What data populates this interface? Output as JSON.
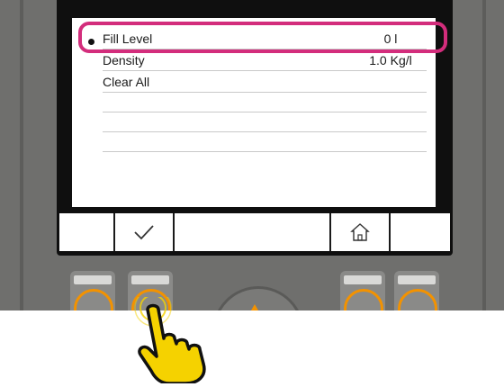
{
  "menu": {
    "items": [
      {
        "label": "Fill Level",
        "value": "0 l",
        "selected": true
      },
      {
        "label": "Density",
        "value": "1.0 Kg/l",
        "selected": false
      },
      {
        "label": "Clear All",
        "value": "",
        "selected": false
      }
    ]
  },
  "softkeys": [
    {
      "icon": ""
    },
    {
      "icon": "checkmark-icon"
    },
    {
      "icon": ""
    },
    {
      "icon": "home-icon"
    },
    {
      "icon": ""
    }
  ],
  "colors": {
    "highlight": "#d32d7c",
    "accent_orange": "#f39200",
    "hand": "#f5d200",
    "housing": "#6f6f6d"
  }
}
